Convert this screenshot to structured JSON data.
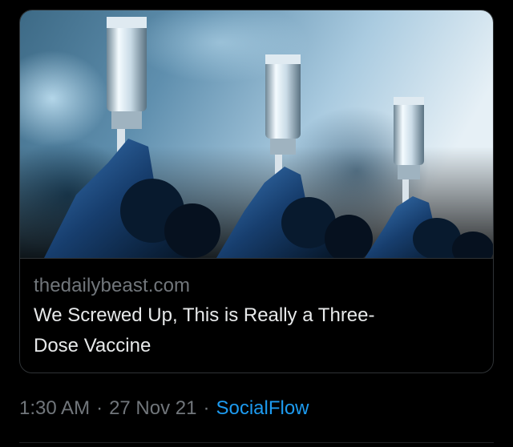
{
  "link_card": {
    "image_icon": "vaccine-vials-syringes-image",
    "domain": "thedailybeast.com",
    "title": "We Screwed Up, This is Really a Three-Dose Vaccine"
  },
  "tweet_meta": {
    "time": "1:30 AM",
    "separator": "·",
    "date": "27 Nov 21",
    "source": "SocialFlow"
  },
  "colors": {
    "background": "#000000",
    "border": "#2f3336",
    "muted_text": "#71767b",
    "primary_text": "#e7e9ea",
    "link_blue": "#1d9bf0"
  }
}
